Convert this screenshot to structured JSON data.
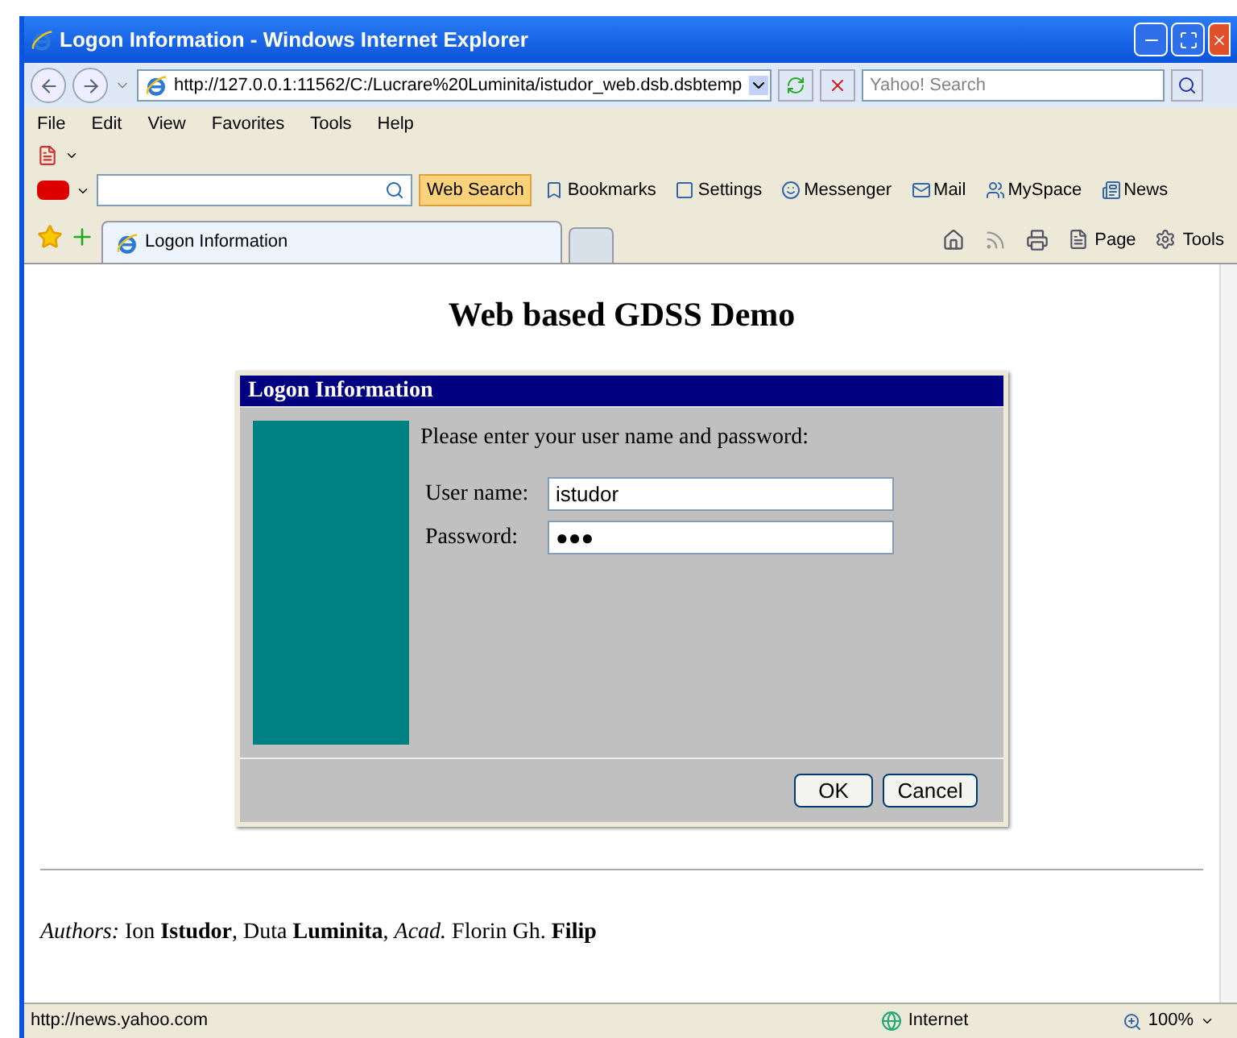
{
  "window": {
    "title": "Logon Information - Windows Internet Explorer"
  },
  "address_bar": {
    "url": "http://127.0.0.1:11562/C:/Lucrare%20Luminita/istudor_web.dsb.dsbtemp",
    "search_placeholder": "Yahoo! Search"
  },
  "menu": [
    "File",
    "Edit",
    "View",
    "Favorites",
    "Tools",
    "Help"
  ],
  "yahoo_toolbar": {
    "search_button": "Web Search",
    "items": [
      "Bookmarks",
      "Settings",
      "Messenger",
      "Mail",
      "MySpace",
      "News"
    ]
  },
  "tabs": [
    {
      "label": "Logon Information",
      "selected": true
    }
  ],
  "command_bar": [
    "Page",
    "Tools"
  ],
  "page": {
    "heading": "Web based GDSS Demo",
    "dialog": {
      "title": "Logon Information",
      "prompt": "Please enter your user name and password:",
      "fields": [
        {
          "label": "User name:",
          "value": "istudor"
        },
        {
          "label": "Password:",
          "value": "●●●"
        }
      ],
      "buttons": [
        "OK",
        "Cancel"
      ]
    },
    "authors": "*Authors:* Ion **Istudor**, Duta **Luminita**, *Acad.* Florin Gh. **Filip**"
  },
  "status_bar": {
    "text": "http://news.yahoo.com",
    "zone": "Internet",
    "zoom": "100%"
  }
}
